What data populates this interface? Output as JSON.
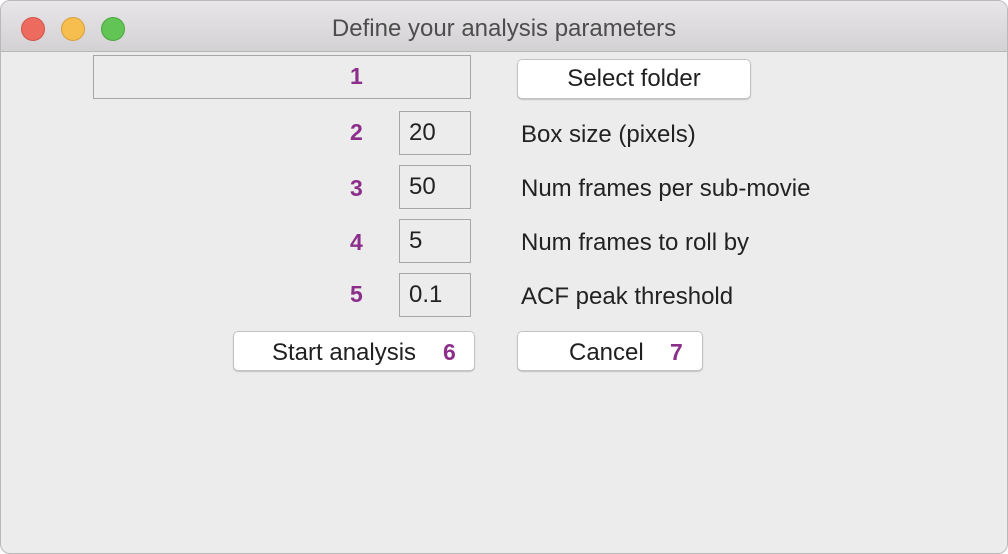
{
  "window": {
    "title": "Define your analysis parameters"
  },
  "markers": {
    "m1": "1",
    "m2": "2",
    "m3": "3",
    "m4": "4",
    "m5": "5",
    "m6": "6",
    "m7": "7"
  },
  "folder": {
    "path_value": "",
    "select_label": "Select folder"
  },
  "params": [
    {
      "value": "20",
      "label": "Box size (pixels)"
    },
    {
      "value": "50",
      "label": "Num frames per sub-movie"
    },
    {
      "value": "5",
      "label": "Num frames to roll by"
    },
    {
      "value": "0.1",
      "label": "ACF peak threshold"
    }
  ],
  "actions": {
    "start_label": "Start analysis",
    "cancel_label": "Cancel"
  },
  "colors": {
    "marker": "#8b2f8b",
    "close": "#ed6a5e",
    "minimize": "#f5be4f",
    "maximize": "#61c454"
  }
}
